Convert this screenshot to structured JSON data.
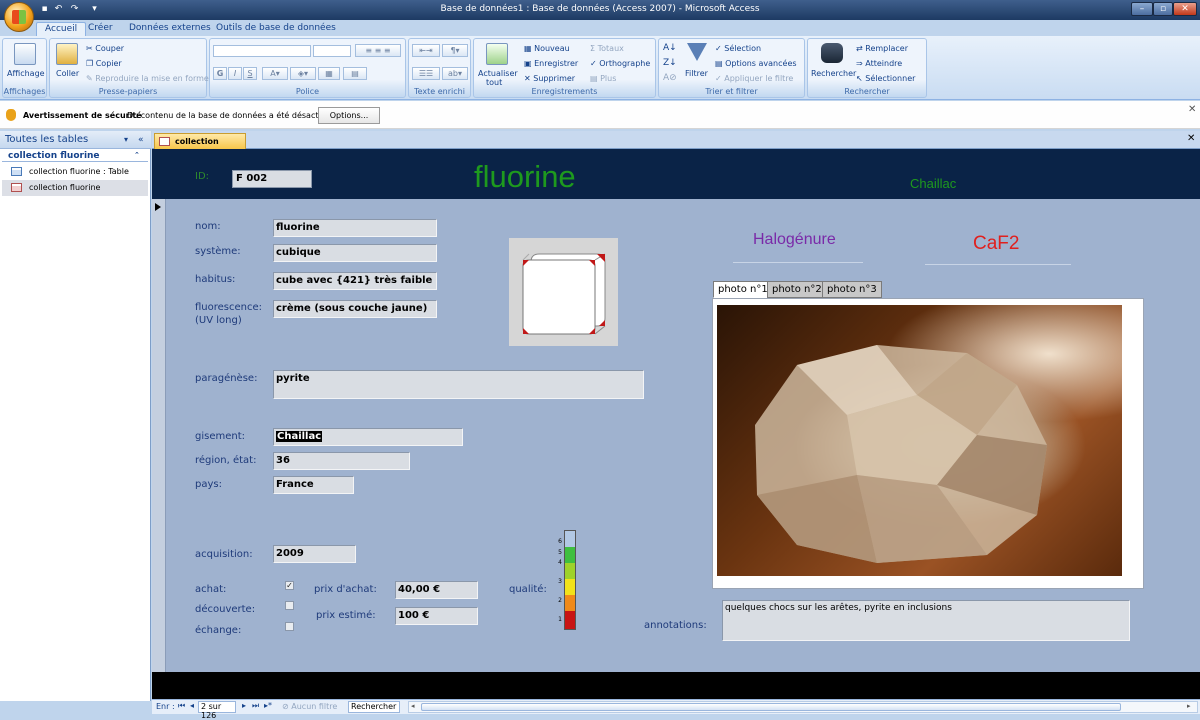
{
  "window": {
    "title": "Base de données1 : Base de données (Access 2007) - Microsoft Access"
  },
  "ribbon_tabs": [
    "Accueil",
    "Créer",
    "Données externes",
    "Outils de base de données"
  ],
  "ribbon": {
    "affichage": {
      "button": "Affichage",
      "group": "Affichages"
    },
    "presse_papiers": {
      "coller": "Coller",
      "couper": "Couper",
      "copier": "Copier",
      "reproduire": "Reproduire la mise en forme",
      "group": "Presse-papiers"
    },
    "police": {
      "group": "Police",
      "bold": "G",
      "italic": "I",
      "underline": "S"
    },
    "texte_enrichi": {
      "group": "Texte enrichi"
    },
    "enregistrements": {
      "actualiser": "Actualiser",
      "actualiser2": "tout",
      "nouveau": "Nouveau",
      "enregistrer": "Enregistrer",
      "supprimer": "Supprimer",
      "totaux": "Totaux",
      "orthographe": "Orthographe",
      "plus": "Plus",
      "group": "Enregistrements"
    },
    "trier": {
      "filtrer": "Filtrer",
      "selection": "Sélection",
      "options": "Options avancées",
      "appliquer": "Appliquer le filtre",
      "group": "Trier et filtrer"
    },
    "rechercher": {
      "rechercher": "Rechercher",
      "remplacer": "Remplacer",
      "atteindre": "Atteindre",
      "selectionner": "Sélectionner",
      "group": "Rechercher"
    }
  },
  "security_bar": {
    "title": "Avertissement de sécurité",
    "message": "Du contenu de la base de données a été désactivé",
    "button": "Options..."
  },
  "nav_pane": {
    "header": "Toutes les tables",
    "group": "collection fluorine",
    "items": [
      "collection fluorine : Table",
      "collection fluorine"
    ]
  },
  "doc_tab": "collection fluorine",
  "form": {
    "header": {
      "id_label": "ID:",
      "id_value": "F 002",
      "name": "fluorine",
      "locality": "Chaillac"
    },
    "class_text": "Halogénure",
    "formula": "CaF2",
    "fields": {
      "nom": {
        "label": "nom:",
        "value": "fluorine"
      },
      "systeme": {
        "label": "système:",
        "value": "cubique"
      },
      "habitus": {
        "label": "habitus:",
        "value": "cube avec {421} très faible"
      },
      "fluorescence": {
        "label": "fluorescence:",
        "label2": "(UV long)",
        "value": "crème (sous couche jaune)"
      },
      "paragenese": {
        "label": "paragénèse:",
        "value": "pyrite"
      },
      "gisement": {
        "label": "gisement:",
        "value": "Chaillac"
      },
      "region": {
        "label": "région, état:",
        "value": "36"
      },
      "pays": {
        "label": "pays:",
        "value": "France"
      },
      "acquisition": {
        "label": "acquisition:",
        "value": "2009"
      },
      "prix_achat": {
        "label": "prix d'achat:",
        "value": "40,00 €"
      },
      "prix_estime": {
        "label": "prix estimé:",
        "value": "100 €"
      },
      "annotations": {
        "label": "annotations:",
        "value": "quelques chocs sur les arêtes, pyrite en inclusions"
      }
    },
    "checks": {
      "achat": {
        "label": "achat:",
        "checked": true
      },
      "decouverte": {
        "label": "découverte:",
        "checked": false
      },
      "echange": {
        "label": "échange:",
        "checked": false
      }
    },
    "quality": {
      "label": "qualité:",
      "scale": [
        "6",
        "5",
        "4",
        "3",
        "2",
        "1"
      ]
    },
    "photo_tabs": [
      "photo n°1",
      "photo n°2",
      "photo n°3"
    ]
  },
  "status": {
    "enr_label": "Enr :",
    "position": "2 sur 126",
    "filter": "Aucun filtre",
    "search": "Rechercher"
  }
}
